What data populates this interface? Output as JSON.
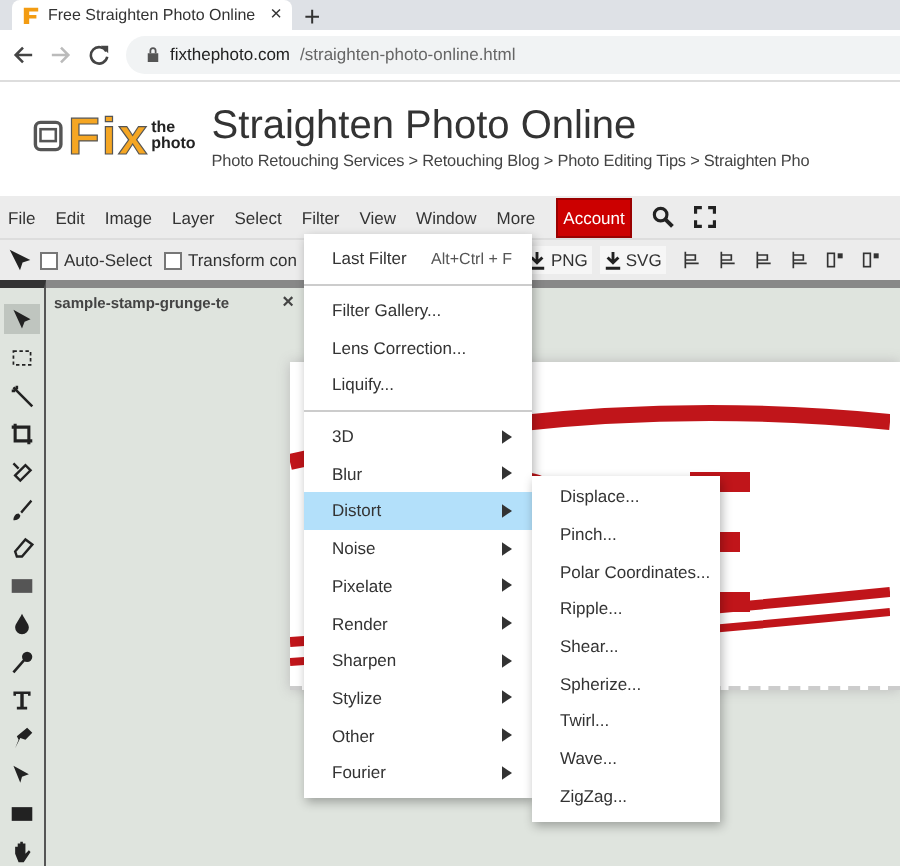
{
  "browser": {
    "tab_title": "Free Straighten Photo Online",
    "tab_close": "×",
    "new_tab": "+",
    "url_domain": "fixthephoto.com",
    "url_path": "/straighten-photo-online.html"
  },
  "site": {
    "logo_main": "Fix",
    "logo_small_1": "the",
    "logo_small_2": "photo",
    "title": "Straighten Photo Online",
    "breadcrumb": "Photo Retouching Services > Retouching Blog > Photo Editing Tips > Straighten Pho"
  },
  "menu_bar": {
    "items": [
      "File",
      "Edit",
      "Image",
      "Layer",
      "Select",
      "Filter",
      "View",
      "Window",
      "More"
    ],
    "account": "Account"
  },
  "options_bar": {
    "checkboxes": [
      {
        "label": "Auto-Select",
        "checked": false
      },
      {
        "label": "Transform con",
        "checked": false
      }
    ],
    "exports": [
      "PNG",
      "SVG"
    ]
  },
  "tools": [
    {
      "selected": true
    },
    {
      "selected": false
    },
    {
      "selected": false
    },
    {
      "selected": false
    },
    {
      "selected": false
    },
    {
      "selected": false
    },
    {
      "selected": false
    },
    {
      "selected": false
    },
    {
      "selected": false
    },
    {
      "selected": false
    },
    {
      "selected": false
    },
    {
      "selected": false
    },
    {
      "selected": false
    },
    {
      "selected": false
    },
    {
      "selected": false
    }
  ],
  "document_tab": {
    "title": "sample-stamp-grunge-te",
    "close": "×"
  },
  "filter_menu": {
    "sections": [
      [
        {
          "kind": "command",
          "label": "Last Filter",
          "shortcut": "Alt+Ctrl + F",
          "selected": false
        }
      ],
      [
        {
          "kind": "command",
          "label": "Filter Gallery...",
          "selected": false
        },
        {
          "kind": "command",
          "label": "Lens Correction...",
          "selected": false
        },
        {
          "kind": "command",
          "label": "Liquify...",
          "selected": false
        }
      ],
      [
        {
          "kind": "submenu",
          "label": "3D",
          "selected": false
        },
        {
          "kind": "submenu",
          "label": "Blur",
          "selected": false
        },
        {
          "kind": "submenu",
          "label": "Distort",
          "selected": true
        },
        {
          "kind": "submenu",
          "label": "Noise",
          "selected": false
        },
        {
          "kind": "submenu",
          "label": "Pixelate",
          "selected": false
        },
        {
          "kind": "submenu",
          "label": "Render",
          "selected": false
        },
        {
          "kind": "submenu",
          "label": "Sharpen",
          "selected": false
        },
        {
          "kind": "submenu",
          "label": "Stylize",
          "selected": false
        },
        {
          "kind": "submenu",
          "label": "Other",
          "selected": false
        },
        {
          "kind": "submenu",
          "label": "Fourier",
          "selected": false
        }
      ]
    ]
  },
  "distort_submenu": {
    "items": [
      "Displace...",
      "Pinch...",
      "Polar Coordinates...",
      "Ripple...",
      "Shear...",
      "Spherize...",
      "Twirl...",
      "Wave...",
      "ZigZag..."
    ]
  }
}
